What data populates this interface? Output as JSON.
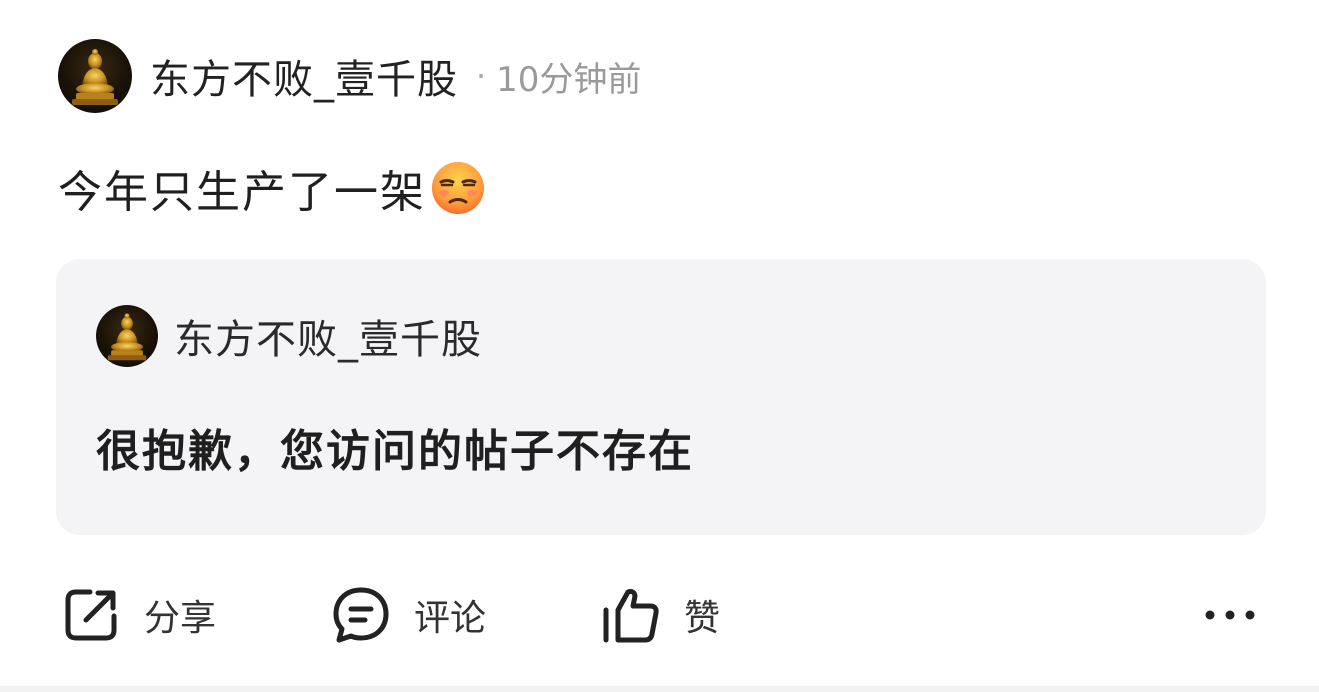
{
  "post": {
    "author": "东方不败_壹千股",
    "separator": "·",
    "time": "10分钟前",
    "content": "今年只生产了一架",
    "emoji": "unamused-face-icon"
  },
  "quote": {
    "author": "东方不败_壹千股",
    "text": "很抱歉，您访问的帖子不存在"
  },
  "actions": {
    "share_label": "分享",
    "comment_label": "评论",
    "like_label": "赞"
  },
  "icons": {
    "avatar": "golden-buddha-avatar",
    "share": "share-icon",
    "comment": "comment-icon",
    "like": "thumbs-up-icon",
    "more": "more-dots-icon"
  },
  "colors": {
    "quote_background": "#f4f4f7",
    "secondary_text": "#9a9a9a"
  }
}
